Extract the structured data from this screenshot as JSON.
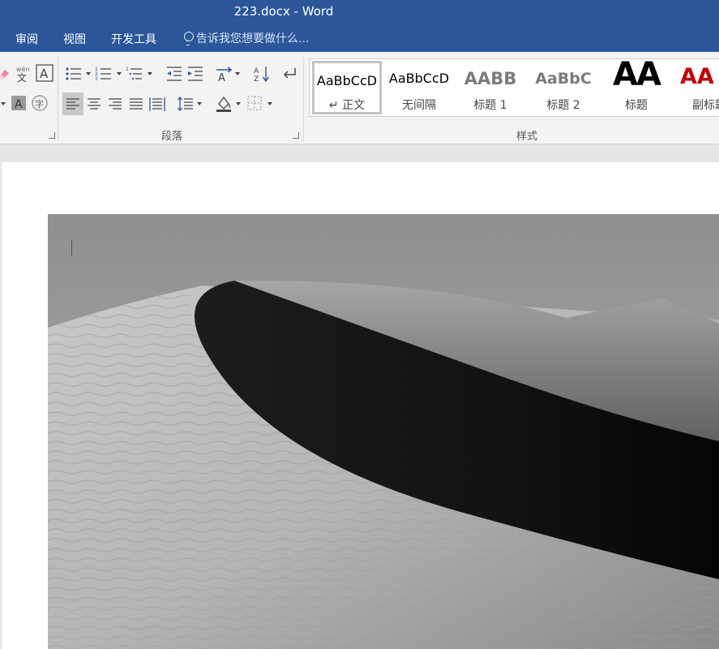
{
  "window": {
    "title": "223.docx - Word"
  },
  "tabs": [
    {
      "label": "审阅"
    },
    {
      "label": "视图"
    },
    {
      "label": "开发工具"
    }
  ],
  "tell_me": {
    "placeholder": "告诉我您想要做什么..."
  },
  "ribbon": {
    "groups": {
      "paragraph": {
        "label": "段落"
      },
      "styles": {
        "label": "样式"
      }
    },
    "font_icons": [
      "clear-formatting-icon",
      "phonetic-guide-icon",
      "character-border-icon",
      "character-shading-icon",
      "enclose-characters-icon"
    ],
    "paragraph_icons": [
      "bullets-icon",
      "numbering-icon",
      "multilevel-list-icon",
      "decrease-indent-icon",
      "increase-indent-icon",
      "chinese-layout-icon",
      "sort-icon",
      "show-marks-icon",
      "align-left-icon",
      "center-icon",
      "align-right-icon",
      "justify-icon",
      "distributed-icon",
      "line-spacing-icon",
      "shading-icon",
      "borders-icon"
    ],
    "gallery": [
      {
        "sample": "AaBbCcD",
        "name": "↵ 正文",
        "selected": true
      },
      {
        "sample": "AaBbCcD",
        "name": "无间隔",
        "selected": false
      },
      {
        "sample": "AABB",
        "name": "标题 1",
        "selected": false
      },
      {
        "sample": "AaBbC",
        "name": "标题 2",
        "selected": false
      },
      {
        "sample": "AA",
        "name": "标题",
        "selected": false
      },
      {
        "sample": "AA",
        "name": "副标题",
        "selected": false
      }
    ]
  },
  "colors": {
    "title_bar": "#2b579a",
    "ribbon": "#f3f3f3",
    "subtitle_red": "#c00000"
  }
}
